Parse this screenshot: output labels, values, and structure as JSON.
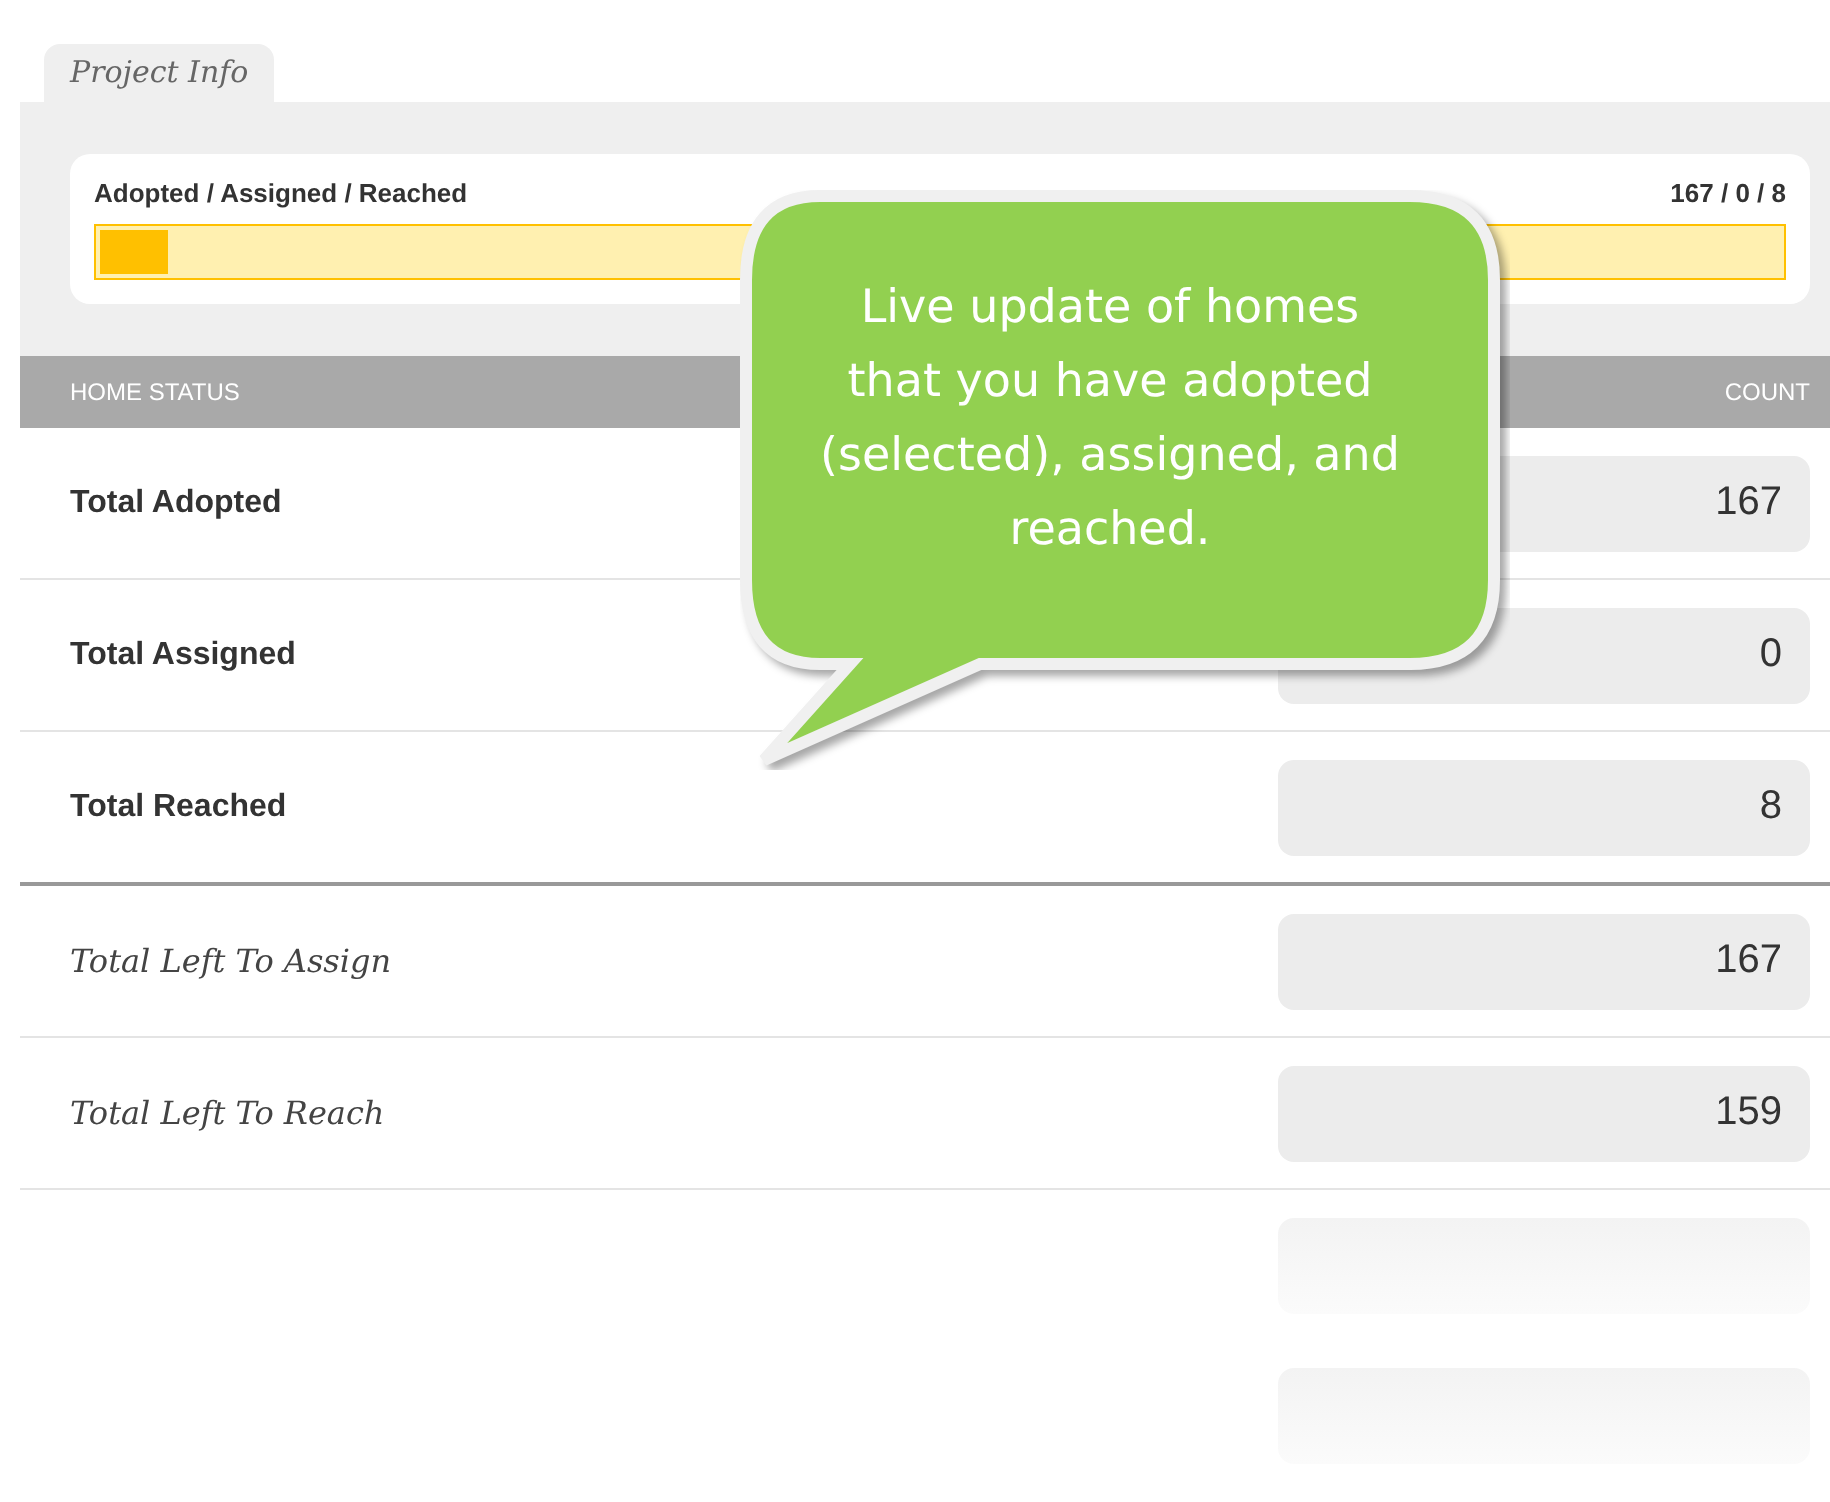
{
  "tabs": [
    {
      "label": "Project Info",
      "selected": true
    }
  ],
  "progress": {
    "label": "Adopted / Assigned / Reached",
    "reading": "167 / 0 / 8",
    "level": 0.04
  },
  "table": {
    "columns": [
      "HOME STATUS",
      "COUNT"
    ],
    "rows": [
      {
        "kind": "total",
        "label": "Total Adopted",
        "value": "167"
      },
      {
        "kind": "total",
        "label": "Total Assigned",
        "value": "0"
      },
      {
        "kind": "total",
        "label": "Total Reached",
        "value": "8"
      },
      {
        "kind": "remaining",
        "label": "Total Left To Assign",
        "value": "167"
      },
      {
        "kind": "remaining",
        "label": "Total Left To Reach",
        "value": "159"
      }
    ]
  },
  "callout": {
    "text": "Live update of homes that you have adopted (selected), assigned, and reached."
  }
}
